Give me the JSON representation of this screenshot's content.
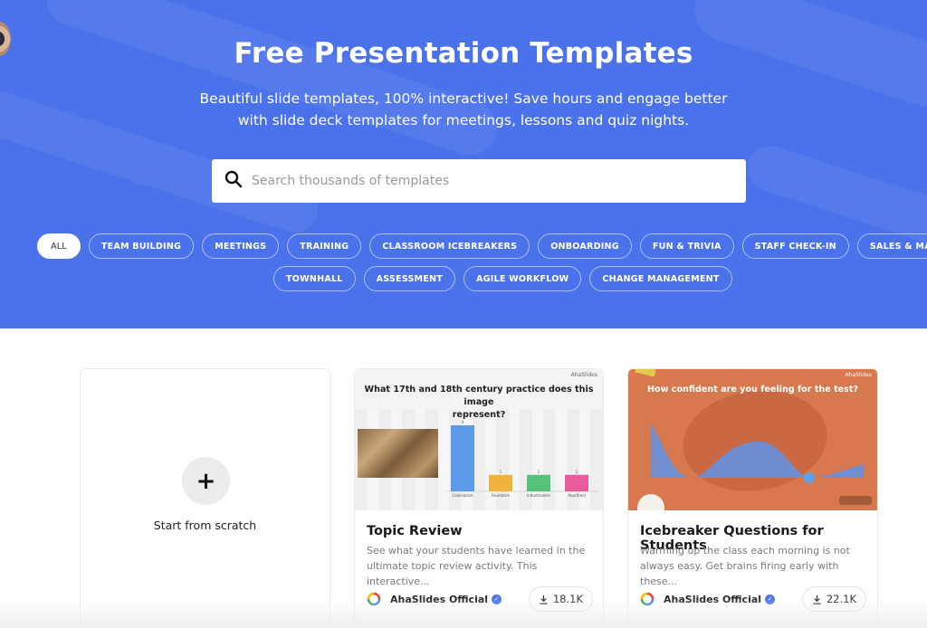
{
  "hero": {
    "title": "Free Presentation Templates",
    "subtitle_line1": "Beautiful slide templates, 100% interactive! Save hours and engage better",
    "subtitle_line2": "with slide deck templates for meetings, lessons and quiz nights.",
    "background_color": "#4a72ea"
  },
  "search": {
    "placeholder": "Search thousands of templates",
    "value": "",
    "icon": "search-icon"
  },
  "categories": {
    "row1": [
      {
        "label": "ALL",
        "active": true
      },
      {
        "label": "TEAM BUILDING",
        "active": false
      },
      {
        "label": "MEETINGS",
        "active": false
      },
      {
        "label": "TRAINING",
        "active": false
      },
      {
        "label": "CLASSROOM ICEBREAKERS",
        "active": false
      },
      {
        "label": "ONBOARDING",
        "active": false
      },
      {
        "label": "FUN & TRIVIA",
        "active": false
      },
      {
        "label": "STAFF CHECK-IN",
        "active": false
      },
      {
        "label": "SALES & MARKETING PITCHES",
        "active": false
      }
    ],
    "row2": [
      {
        "label": "TOWNHALL",
        "active": false
      },
      {
        "label": "ASSESSMENT",
        "active": false
      },
      {
        "label": "AGILE WORKFLOW",
        "active": false
      },
      {
        "label": "CHANGE MANAGEMENT",
        "active": false
      }
    ]
  },
  "scratch_card": {
    "icon": "plus-icon",
    "label": "Start from scratch"
  },
  "templates": [
    {
      "title": "Topic Review",
      "description_line1": "See what your students have learned in the",
      "description_line2": "ultimate topic review activity. This interactive...",
      "author": "AhaSlides Official",
      "verified": true,
      "downloads": "18.1K",
      "preview": {
        "brand": "AhaSlides",
        "question_line1": "What 17th and 18th century practice does this image",
        "question_line2": "represent?",
        "bars": [
          {
            "label": "Colonialism",
            "value": 4,
            "color": "#5b9bea"
          },
          {
            "label": "Feudalism",
            "value": 1,
            "color": "#f2b33d"
          },
          {
            "label": "Industrialism",
            "value": 1,
            "color": "#56c17a"
          },
          {
            "label": "Apartheid",
            "value": 1,
            "color": "#ea5a9c"
          }
        ]
      }
    },
    {
      "title": "Icebreaker Questions for Students",
      "description_line1": "Warming up the class each morning is not",
      "description_line2": "always easy. Get brains firing early with these...",
      "author": "AhaSlides Official",
      "verified": true,
      "downloads": "22.1K",
      "preview": {
        "brand": "AhaSlides",
        "question": "How confident are you feeling for the test?",
        "background_color": "#d7784e",
        "series_color": "#6a8fd6"
      }
    }
  ]
}
